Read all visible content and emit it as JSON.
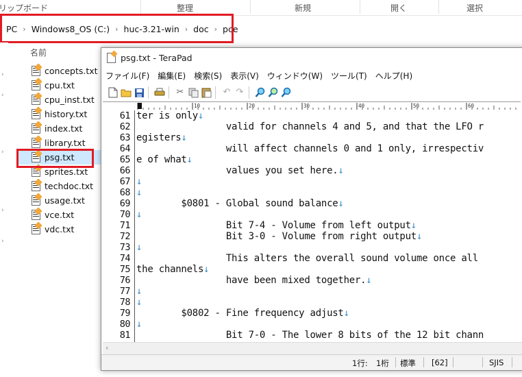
{
  "explorer": {
    "ribbon_groups": [
      "リップボード",
      "整理",
      "新規",
      "開く",
      "選択"
    ],
    "breadcrumbs": [
      "PC",
      "Windows8_OS (C:)",
      "huc-3.21-win",
      "doc",
      "pce"
    ],
    "column_header": "名前",
    "files": [
      {
        "name": "concepts.txt",
        "selected": false
      },
      {
        "name": "cpu.txt",
        "selected": false
      },
      {
        "name": "cpu_inst.txt",
        "selected": false
      },
      {
        "name": "history.txt",
        "selected": false
      },
      {
        "name": "index.txt",
        "selected": false
      },
      {
        "name": "library.txt",
        "selected": false
      },
      {
        "name": "psg.txt",
        "selected": true
      },
      {
        "name": "sprites.txt",
        "selected": false
      },
      {
        "name": "techdoc.txt",
        "selected": false
      },
      {
        "name": "usage.txt",
        "selected": false
      },
      {
        "name": "vce.txt",
        "selected": false
      },
      {
        "name": "vdc.txt",
        "selected": false
      }
    ],
    "highlight_color": "#e11b24"
  },
  "terapad": {
    "title": "psg.txt - TeraPad",
    "menu": [
      "ファイル(F)",
      "編集(E)",
      "検索(S)",
      "表示(V)",
      "ウィンドウ(W)",
      "ツール(T)",
      "ヘルプ(H)"
    ],
    "toolbar_icons": [
      "new-file-icon",
      "open-folder-icon",
      "save-icon",
      "print-icon",
      "cut-icon",
      "copy-icon",
      "paste-icon",
      "undo-icon",
      "redo-icon",
      "find-icon",
      "find-next-icon",
      "find-prev-icon"
    ],
    "ruler_labels": [
      "10",
      "20",
      "30",
      "40",
      "50",
      "60"
    ],
    "lines": [
      {
        "n": "61",
        "text": "ter is only",
        "nl": true
      },
      {
        "n": "62",
        "text": "                valid for channels 4 and 5, and that the LFO r",
        "nl": false
      },
      {
        "n": "63",
        "text": "egisters",
        "nl": true
      },
      {
        "n": "64",
        "text": "                will affect channels 0 and 1 only, irrespectiv",
        "nl": false
      },
      {
        "n": "65",
        "text": "e of what",
        "nl": true
      },
      {
        "n": "66",
        "text": "                values you set here.",
        "nl": true
      },
      {
        "n": "67",
        "text": "",
        "nl": true
      },
      {
        "n": "68",
        "text": "",
        "nl": true
      },
      {
        "n": "69",
        "text": "        $0801 - Global sound balance",
        "nl": true
      },
      {
        "n": "70",
        "text": "",
        "nl": true
      },
      {
        "n": "71",
        "text": "                Bit 7-4 - Volume from left output",
        "nl": true
      },
      {
        "n": "72",
        "text": "                Bit 3-0 - Volume from right output",
        "nl": true
      },
      {
        "n": "73",
        "text": "",
        "nl": true
      },
      {
        "n": "74",
        "text": "                This alters the overall sound volume once all",
        "nl": false
      },
      {
        "n": "75",
        "text": "the channels",
        "nl": true
      },
      {
        "n": "76",
        "text": "                have been mixed together.",
        "nl": true
      },
      {
        "n": "77",
        "text": "",
        "nl": true
      },
      {
        "n": "78",
        "text": "",
        "nl": true
      },
      {
        "n": "79",
        "text": "        $0802 - Fine frequency adjust",
        "nl": true
      },
      {
        "n": "80",
        "text": "",
        "nl": true
      },
      {
        "n": "81",
        "text": "                Bit 7-0 - The lower 8 bits of the 12 bit chann",
        "nl": false
      }
    ],
    "newline_mark": "↓",
    "status": {
      "line": "1行:",
      "col": "1桁",
      "mode": "標準",
      "code": "[62]",
      "encoding": "SJIS"
    }
  }
}
